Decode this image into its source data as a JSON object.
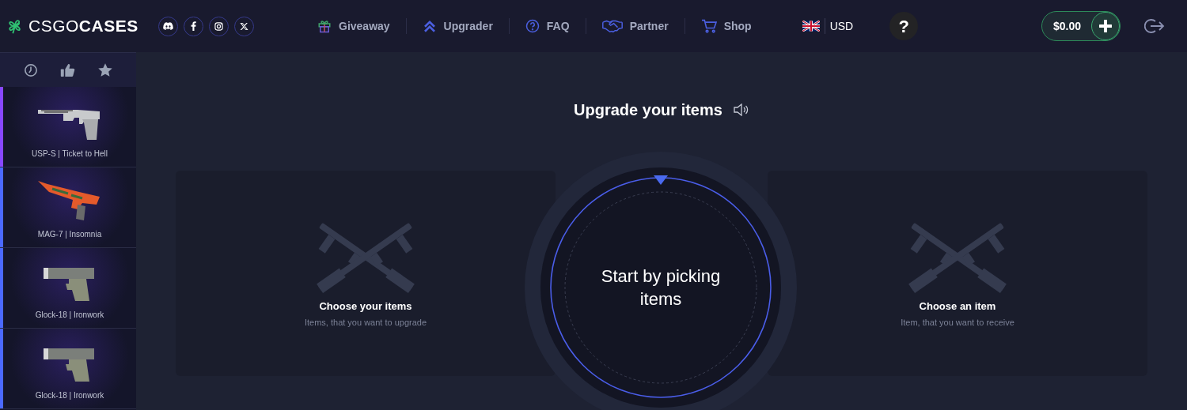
{
  "header": {
    "logo": "CSGO**CASES**",
    "socials": [
      {
        "kind": "discord"
      },
      {
        "kind": "facebook"
      },
      {
        "kind": "instagram"
      },
      {
        "kind": "x"
      }
    ],
    "nav": [
      {
        "label": "Giveaway",
        "kind": "gift"
      },
      {
        "label": "Upgrader",
        "kind": "upgrade"
      },
      {
        "label": "FAQ",
        "kind": "faq"
      },
      {
        "label": "Partner",
        "kind": "partner"
      },
      {
        "label": "Shop",
        "kind": "shop"
      }
    ],
    "currency": "USD",
    "help": "?",
    "balance": "$0.00"
  },
  "sidebar": {
    "filters": [
      {
        "kind": "recent"
      },
      {
        "kind": "top"
      },
      {
        "kind": "favorite"
      }
    ],
    "drops": [
      {
        "name": "USP-S | Ticket to Hell",
        "color": "#8847ff",
        "kind": "usp"
      },
      {
        "name": "MAG-7 | Insomnia",
        "color": "#4b69ff",
        "kind": "mag"
      },
      {
        "name": "Glock-18 | Ironwork",
        "color": "#4b69ff",
        "kind": "glock"
      },
      {
        "name": "Glock-18 | Ironwork",
        "color": "#4b69ff",
        "kind": "glock"
      }
    ]
  },
  "upgrader": {
    "title": "Upgrade your items",
    "center_text": "Start by picking items",
    "left_panel": {
      "title": "Choose your items",
      "subtitle": "Items, that you want to upgrade"
    },
    "right_panel": {
      "title": "Choose an item",
      "subtitle": "Item, that you want to receive"
    }
  }
}
